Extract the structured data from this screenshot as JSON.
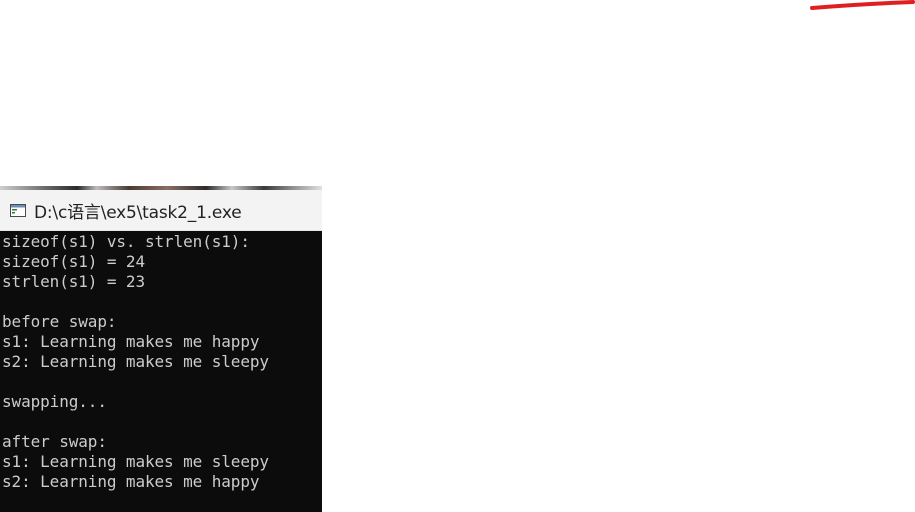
{
  "colors": {
    "annotation_red": "#e02020",
    "console_background": "#0c0c0c",
    "console_text": "#cccccc",
    "titlebar_background": "#f3f3f3"
  },
  "window": {
    "title": "D:\\c语言\\ex5\\task2_1.exe",
    "icon": "console-app-icon"
  },
  "console": {
    "lines": [
      "sizeof(s1) vs. strlen(s1):",
      "sizeof(s1) = 24",
      "strlen(s1) = 23",
      "",
      "before swap:",
      "s1: Learning makes me happy",
      "s2: Learning makes me sleepy",
      "",
      "swapping...",
      "",
      "after swap:",
      "s1: Learning makes me sleepy",
      "s2: Learning makes me happy"
    ]
  }
}
